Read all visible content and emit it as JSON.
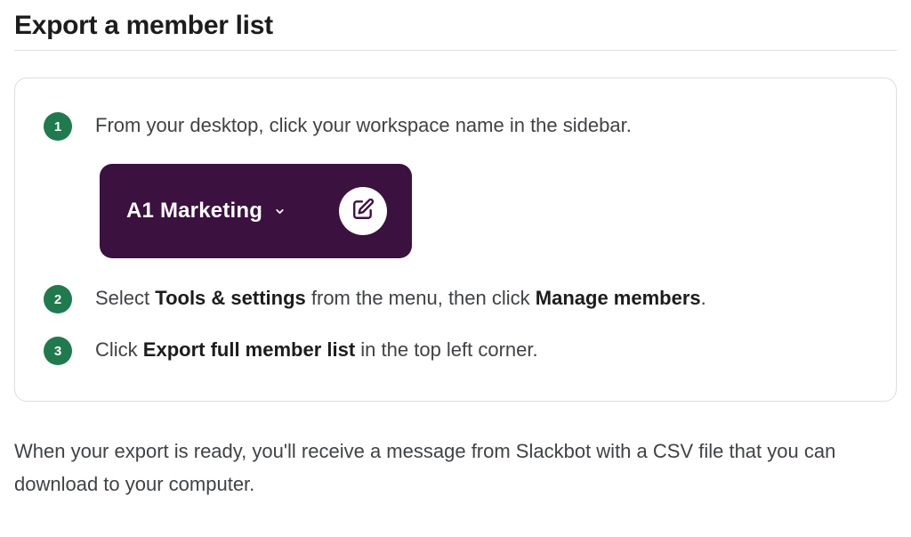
{
  "title": "Export a member list",
  "steps": {
    "one": {
      "num": "1",
      "text": "From your desktop, click your workspace name in the sidebar."
    },
    "two": {
      "num": "2",
      "prefix": "Select ",
      "bold1": "Tools & settings",
      "mid": " from the menu, then click ",
      "bold2": "Manage members",
      "suffix": "."
    },
    "three": {
      "num": "3",
      "prefix": "Click ",
      "bold1": "Export full member list",
      "suffix": " in the top left corner."
    }
  },
  "workspace": {
    "name": "A1 Marketing"
  },
  "footer": "When your export is ready, you'll receive a message from Slackbot with a CSV file that you can download to your computer."
}
